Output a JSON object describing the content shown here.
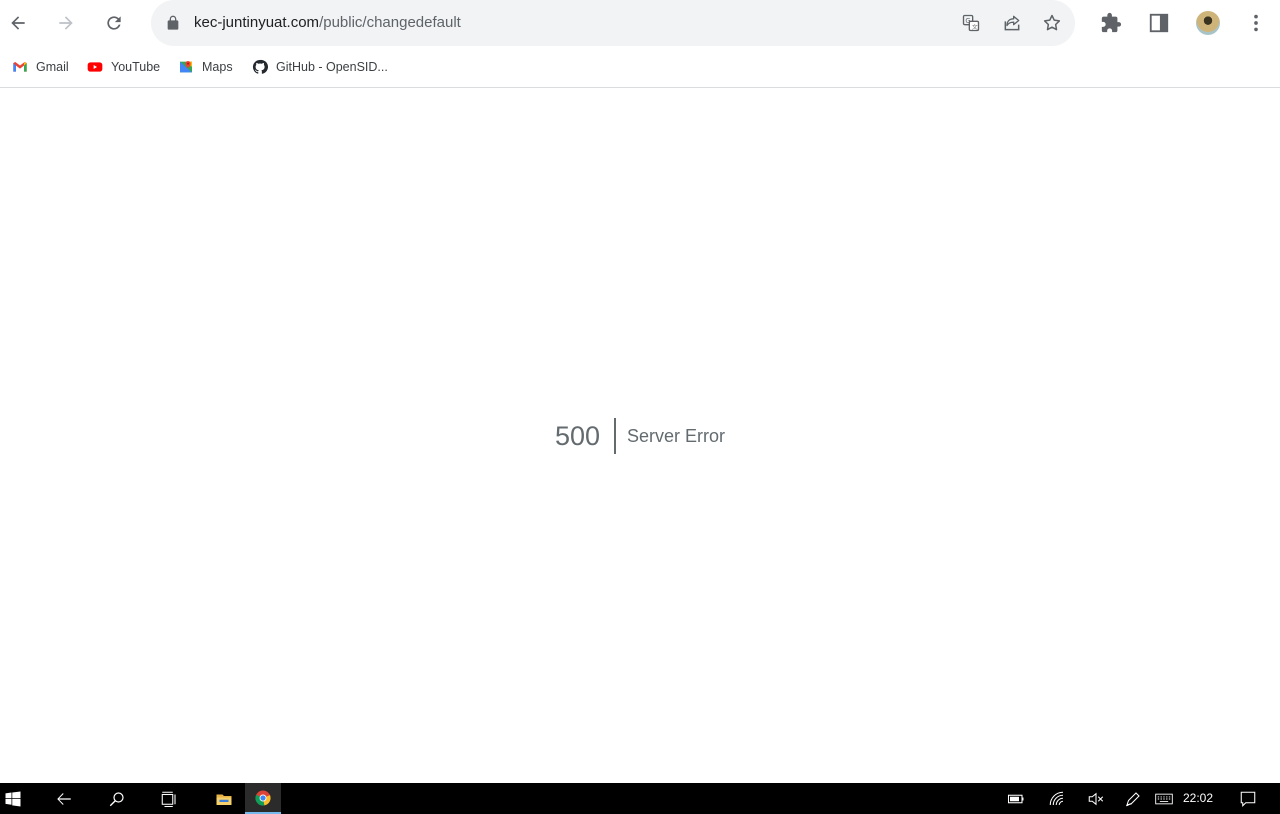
{
  "browser": {
    "url_host": "kec-juntinyuat.com",
    "url_path": "/public/changedefault"
  },
  "bookmarks": [
    {
      "label": "Gmail",
      "icon": "gmail-icon"
    },
    {
      "label": "YouTube",
      "icon": "youtube-icon"
    },
    {
      "label": "Maps",
      "icon": "maps-icon"
    },
    {
      "label": "GitHub - OpenSID...",
      "icon": "github-icon"
    }
  ],
  "page": {
    "error_code": "500",
    "error_message": "Server Error"
  },
  "taskbar": {
    "clock": "22:02"
  },
  "colors": {
    "error_text": "#636b6f",
    "omnibox_bg": "#f1f3f4",
    "taskbar_bg": "#000000",
    "taskbar_active_indicator": "#76b9ed"
  }
}
